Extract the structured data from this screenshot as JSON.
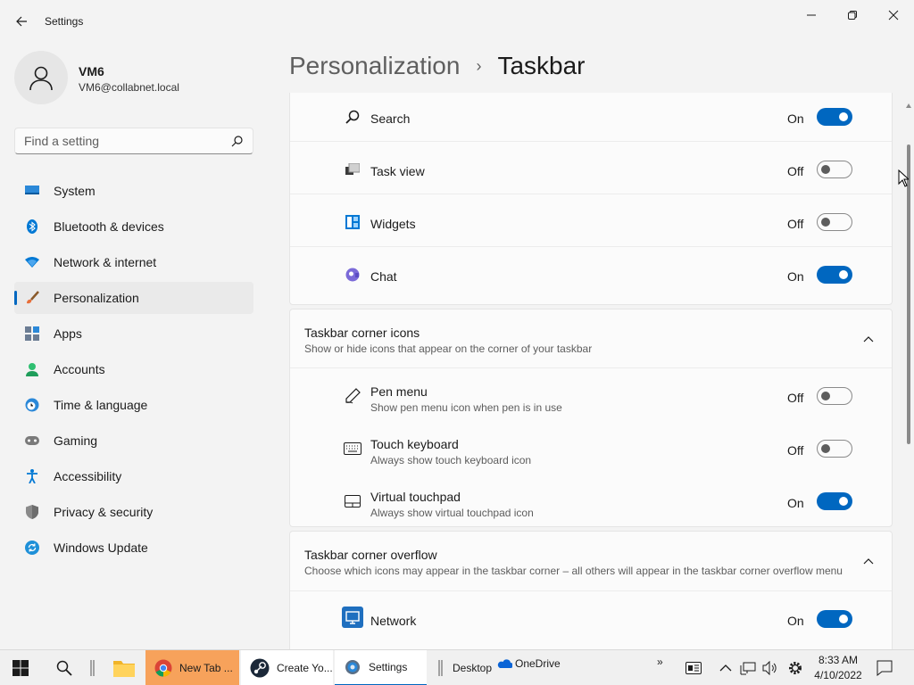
{
  "window": {
    "app_title": "Settings"
  },
  "user": {
    "name": "VM6",
    "email": "VM6@collabnet.local"
  },
  "search": {
    "placeholder": "Find a setting"
  },
  "nav": [
    {
      "label": "System",
      "icon": "monitor-icon"
    },
    {
      "label": "Bluetooth & devices",
      "icon": "bluetooth-icon"
    },
    {
      "label": "Network & internet",
      "icon": "wifi-icon"
    },
    {
      "label": "Personalization",
      "icon": "brush-icon",
      "active": true
    },
    {
      "label": "Apps",
      "icon": "apps-icon"
    },
    {
      "label": "Accounts",
      "icon": "person-icon"
    },
    {
      "label": "Time & language",
      "icon": "clock-globe-icon"
    },
    {
      "label": "Gaming",
      "icon": "gamepad-icon"
    },
    {
      "label": "Accessibility",
      "icon": "accessibility-icon"
    },
    {
      "label": "Privacy & security",
      "icon": "shield-icon"
    },
    {
      "label": "Windows Update",
      "icon": "update-icon"
    }
  ],
  "header": {
    "parent": "Personalization",
    "separator": "›",
    "current": "Taskbar"
  },
  "taskbar_items": [
    {
      "label": "Search",
      "state": "On",
      "on": true,
      "icon": "search-icon"
    },
    {
      "label": "Task view",
      "state": "Off",
      "on": false,
      "icon": "task-view-icon"
    },
    {
      "label": "Widgets",
      "state": "Off",
      "on": false,
      "icon": "widgets-icon"
    },
    {
      "label": "Chat",
      "state": "On",
      "on": true,
      "icon": "chat-icon"
    }
  ],
  "corner_icons": {
    "title": "Taskbar corner icons",
    "description": "Show or hide icons that appear on the corner of your taskbar",
    "items": [
      {
        "label": "Pen menu",
        "description": "Show pen menu icon when pen is in use",
        "state": "Off",
        "on": false,
        "icon": "pen-icon"
      },
      {
        "label": "Touch keyboard",
        "description": "Always show touch keyboard icon",
        "state": "Off",
        "on": false,
        "icon": "keyboard-icon"
      },
      {
        "label": "Virtual touchpad",
        "description": "Always show virtual touchpad icon",
        "state": "On",
        "on": true,
        "icon": "touchpad-icon"
      }
    ]
  },
  "corner_overflow": {
    "title": "Taskbar corner overflow",
    "description": "Choose which icons may appear in the taskbar corner – all others will appear in the taskbar corner overflow menu",
    "items": [
      {
        "label": "Network",
        "state": "On",
        "on": true,
        "icon": "network-icon"
      }
    ]
  },
  "os_taskbar": {
    "apps": [
      {
        "label": "New Tab ...",
        "icon": "chrome-icon"
      },
      {
        "label": "Create Yo...",
        "icon": "steam-icon"
      },
      {
        "label": "Settings",
        "icon": "settings-gear-icon"
      }
    ],
    "toolbar_desktop": "Desktop",
    "toolbar_onedrive": "OneDrive",
    "overflow_glyph": "»",
    "time": "8:33 AM",
    "date": "4/10/2022"
  },
  "colors": {
    "accent": "#0067c0",
    "chrome_highlight": "#f7a25b"
  }
}
